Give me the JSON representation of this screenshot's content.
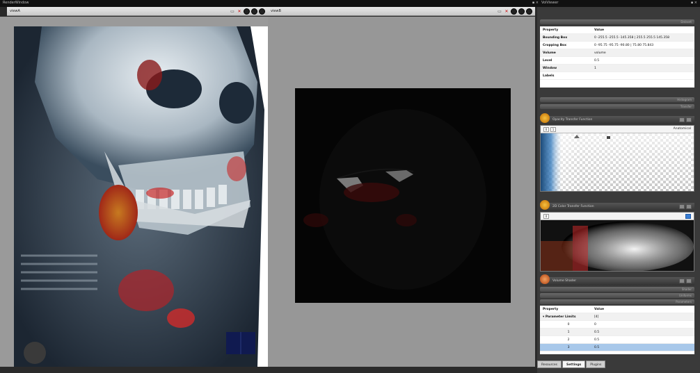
{
  "window": {
    "left_title": "RenderWindow",
    "right_title": "VolViewer",
    "title_buttons": "▪ ×",
    "right_buttons": "▪ ×"
  },
  "views": [
    {
      "name": "viewA",
      "tool_icons": [
        "maximize-icon",
        "camera-icon",
        "circle-icon",
        "circle-icon",
        "circle-icon"
      ]
    },
    {
      "name": "viewB",
      "tool_icons": [
        "maximize-icon",
        "camera-icon",
        "circle-icon",
        "circle-icon",
        "circle-icon"
      ]
    }
  ],
  "properties": {
    "header": {
      "property": "Property",
      "value": "Value"
    },
    "rows": [
      {
        "property": "Bounding Box",
        "value": "0 -255.5 -255.5 -145.358 | 255.5 255.5 145.358"
      },
      {
        "property": "Cropping Box",
        "value": "0 -95.75 -95.75 -90.80 | 75.80 75.843"
      },
      {
        "property": "Volume",
        "value": "volume"
      },
      {
        "property": "Level",
        "value": "0.5"
      },
      {
        "property": "Window",
        "value": "1"
      },
      {
        "property": "Labels",
        "value": ""
      }
    ]
  },
  "bars": {
    "top": "Dataset",
    "mid1": "Histogram",
    "mid2": "Transfer"
  },
  "opacity_function": {
    "title": "Opacity Transfer Function",
    "right_label": "Anatomical",
    "tb1": "0",
    "tb2": "1"
  },
  "color_function": {
    "title": "2D Color Transfer Function",
    "tb1": "0"
  },
  "volume_shader": {
    "title": "Volume Shader",
    "bar1": "Shader",
    "bar2": "Uniforms",
    "bar3": "Parameters",
    "header": {
      "property": "Property",
      "value": "Value"
    },
    "rows": [
      {
        "property": "▾ Parameter Limits",
        "value": "[4]"
      },
      {
        "property": "0",
        "value": "0"
      },
      {
        "property": "1",
        "value": "0.5"
      },
      {
        "property": "2",
        "value": "0.5"
      },
      {
        "property": "3",
        "value": "0.5"
      }
    ],
    "selected_row": 4
  },
  "tabs": [
    "Resources",
    "Settings",
    "Plugins"
  ],
  "active_tab": "Settings",
  "colors": {
    "accent": "#3a7fd5",
    "selected": "#a8c8ea",
    "red": "#c82a2a"
  }
}
